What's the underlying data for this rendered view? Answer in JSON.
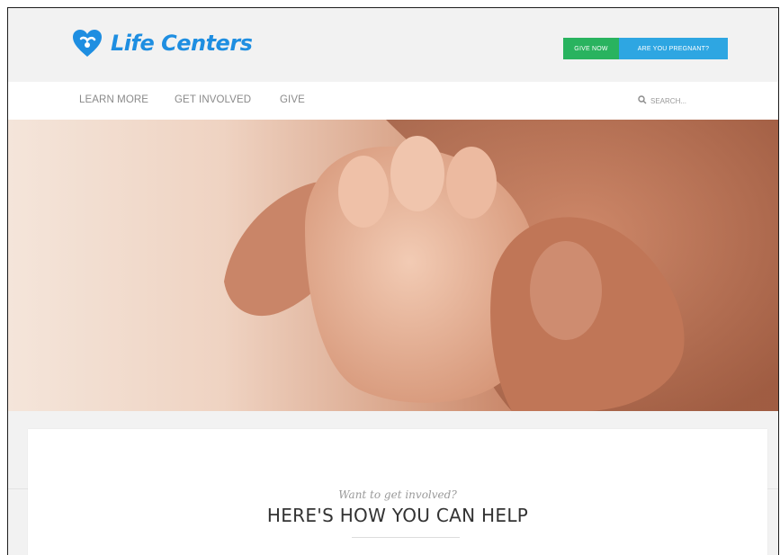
{
  "brand": {
    "name": "Life Centers",
    "color": "#1e8ee1"
  },
  "cta": {
    "give_now": "GIVE NOW",
    "pregnant": "ARE YOU PREGNANT?"
  },
  "nav": {
    "items": [
      "LEARN MORE",
      "GET INVOLVED",
      "GIVE"
    ]
  },
  "search": {
    "placeholder": "SEARCH..."
  },
  "section": {
    "tagline": "Want to get involved?",
    "headline": "HERE'S HOW YOU CAN HELP"
  },
  "colors": {
    "green": "#29b35f",
    "blue": "#2ea6e2",
    "accent": "#1e8ee1"
  },
  "icons": {
    "logo": "heart-hands-icon",
    "search": "search-icon"
  }
}
